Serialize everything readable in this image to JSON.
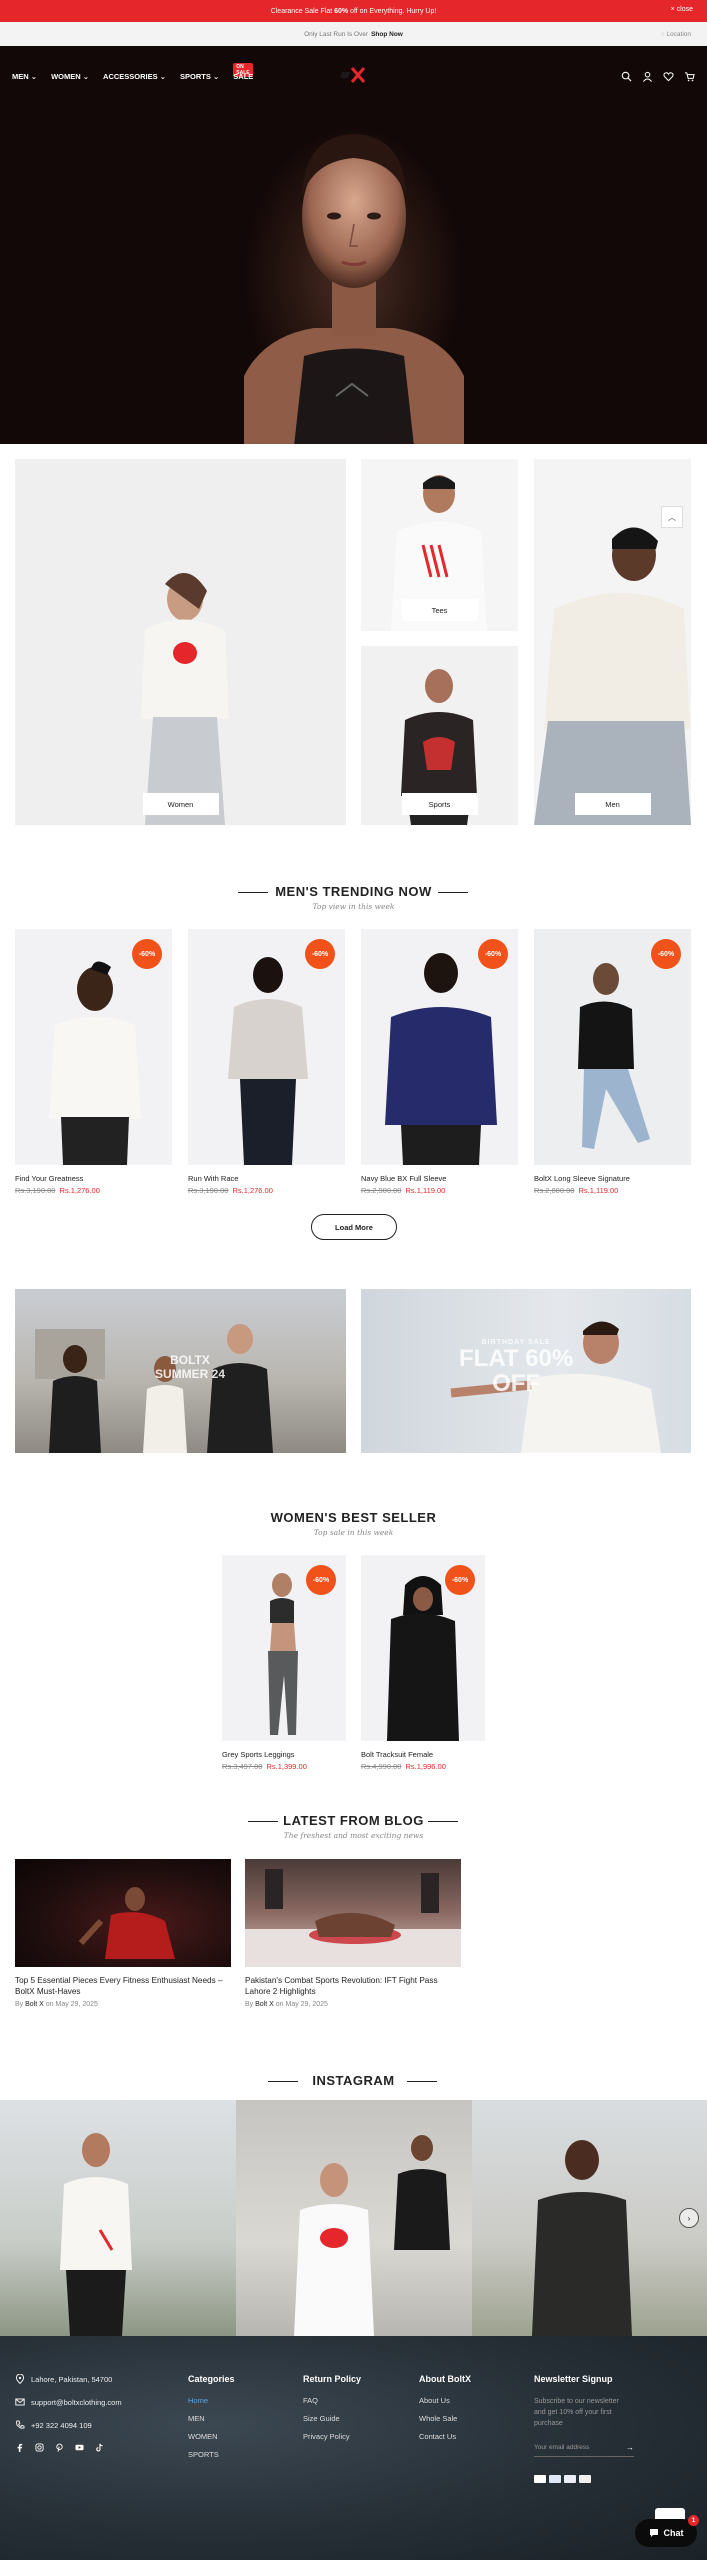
{
  "announcement": {
    "text_prefix": "Clearance Sale Flat ",
    "text_bold": "60%",
    "text_suffix": " off on Everything. Hurry Up!",
    "close_label": "× close"
  },
  "subbar": {
    "text": "Only Last Run Is Over",
    "link": "Shop Now",
    "location": "Location"
  },
  "nav": {
    "items": [
      {
        "label": "MEN",
        "chevron": "⌄"
      },
      {
        "label": "WOMEN",
        "chevron": "⌄"
      },
      {
        "label": "ACCESSORIES",
        "chevron": "⌄"
      },
      {
        "label": "SPORTS",
        "chevron": "⌄"
      },
      {
        "label": "SALE",
        "chevron": ""
      }
    ],
    "sale_badge": "ON SALE",
    "cart_count": "0",
    "icons": [
      "search-icon",
      "account-icon",
      "wishlist-icon",
      "cart-icon"
    ]
  },
  "categories": [
    {
      "label": "Women"
    },
    {
      "label": "Tees"
    },
    {
      "label": "Sports"
    },
    {
      "label": "Men"
    }
  ],
  "trending": {
    "title": "MEN'S TRENDING NOW",
    "subtitle": "Top view in this week",
    "load_more": "Load More",
    "products": [
      {
        "name": "Find Your Greatness",
        "old_price": "Rs.3,190.00",
        "new_price": "Rs.1,276.00",
        "badge": "-60%"
      },
      {
        "name": "Run With Race",
        "old_price": "Rs.3,190.00",
        "new_price": "Rs.1,276.00",
        "badge": "-60%"
      },
      {
        "name": "Navy Blue BX Full Sleeve",
        "old_price": "Rs.2,900.00",
        "new_price": "Rs.1,119.00",
        "badge": "-60%"
      },
      {
        "name": "BoltX Long Sleeve Signature",
        "old_price": "Rs.2,800.00",
        "new_price": "Rs.1,119.00",
        "badge": "-60%"
      }
    ]
  },
  "promos": [
    {
      "line1": "BOLTX",
      "line2": "SUMMER 24"
    },
    {
      "line1": "BIRTHDAY SALE",
      "line2": "FLAT 60%",
      "line3": "OFF"
    }
  ],
  "women": {
    "title": "WOMEN'S BEST SELLER",
    "subtitle": "Top sale in this week",
    "products": [
      {
        "name": "Grey Sports Leggings",
        "old_price": "Rs.3,497.00",
        "new_price": "Rs.1,399.00",
        "badge": "-60%"
      },
      {
        "name": "Bolt Tracksuit Female",
        "old_price": "Rs.4,990.00",
        "new_price": "Rs.1,996.00",
        "badge": "-60%"
      }
    ]
  },
  "blog": {
    "title": "LATEST FROM BLOG",
    "subtitle": "The freshest and most exciting news",
    "posts": [
      {
        "title": "Top 5 Essential Pieces Every Fitness Enthusiast Needs – BoltX Must-Haves",
        "by": "By",
        "author": "Bolt X",
        "on": "on May 29, 2025"
      },
      {
        "title": "Pakistan's Combat Sports Revolution: IFT Fight Pass Lahore 2 Highlights",
        "by": "By",
        "author": "Bolt X",
        "on": "on May 29, 2025"
      }
    ]
  },
  "instagram": {
    "title": "INSTAGRAM"
  },
  "footer": {
    "address": "Lahore, Pakistan, 54700",
    "email": "support@boltxclothing.com",
    "phone": "+92 322 4094 109",
    "socials": [
      "facebook-icon",
      "instagram-icon",
      "pinterest-icon",
      "youtube-icon",
      "tiktok-icon"
    ],
    "categories": {
      "title": "Categories",
      "items": [
        "Home",
        "MEN",
        "WOMEN",
        "SPORTS"
      ]
    },
    "returns": {
      "title": "Return Policy",
      "items": [
        "FAQ",
        "Size Guide",
        "Privacy Policy"
      ]
    },
    "about": {
      "title": "About BoltX",
      "items": [
        "About Us",
        "Whole Sale",
        "Contact Us"
      ]
    },
    "newsletter": {
      "title": "Newsletter Signup",
      "text": "Subscribe to our newsletter and get 10% off your first purchase",
      "placeholder": "Your email address",
      "payments": [
        "mastercard-icon",
        "visa-icon",
        "paypal-icon",
        "card-icon"
      ]
    }
  },
  "chat": {
    "label": "Chat",
    "count": "1"
  },
  "colors": {
    "brand_red": "#e5262b",
    "badge_orange": "#f1521a",
    "footer_bg": "#262f36",
    "link_blue": "#5aa7e8"
  }
}
